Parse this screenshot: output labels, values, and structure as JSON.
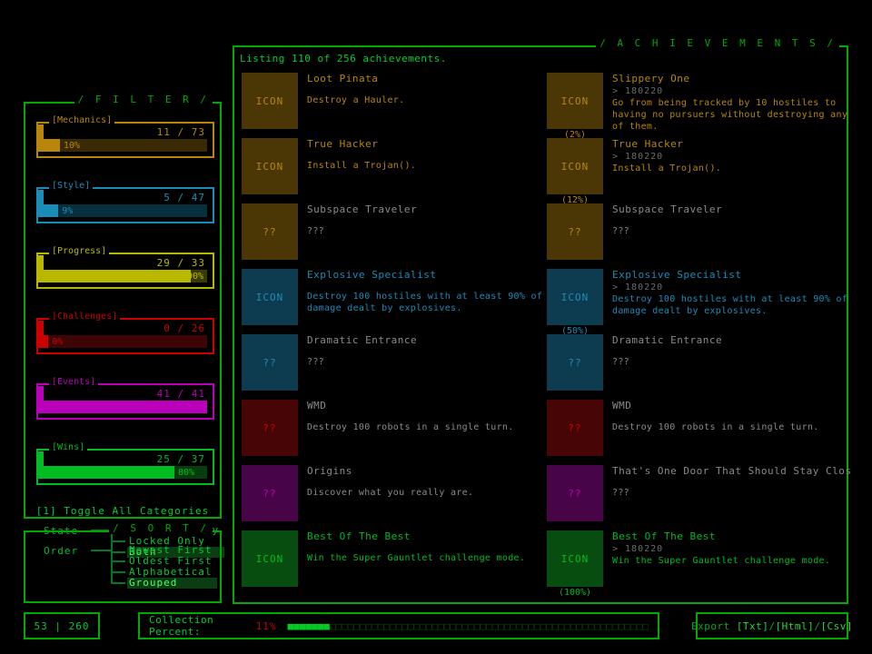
{
  "theme": {
    "green": "#00aa00",
    "bright_green": "#22dd33",
    "background": "#000000",
    "locked_text": "#8a8a8a"
  },
  "filter_panel": {
    "title": "/ F I L T E R /",
    "categories": [
      {
        "label": "[Mechanics]",
        "count": "11 / 73",
        "percent_label": "10%",
        "percent": 10,
        "color": "#b8860b",
        "dim": "#3a2a04"
      },
      {
        "label": "[Style]",
        "count": "5 / 47",
        "percent_label": "9%",
        "percent": 9,
        "color": "#1a8cb8",
        "dim": "#07303f"
      },
      {
        "label": "[Progress]",
        "count": "29 / 33",
        "percent_label": "90%",
        "percent": 90,
        "color": "#b8b800",
        "dim": "#3a3a05"
      },
      {
        "label": "[Challenges]",
        "count": "0 / 26",
        "percent_label": "0%",
        "percent": 0,
        "color": "#cc0000",
        "dim": "#3d0505"
      },
      {
        "label": "[Events]",
        "count": "41 / 41",
        "percent_label": "",
        "percent": 100,
        "color": "#bb00bb",
        "dim": "#3a043a"
      },
      {
        "label": "[Wins]",
        "count": "25 / 37",
        "percent_label": "80%",
        "percent": 80,
        "color": "#00bb22",
        "dim": "#053d0d"
      }
    ],
    "toggle_all": "[1] Toggle All Categories",
    "state": {
      "key": "State",
      "options": [
        "Unlocked Only",
        "Locked Only",
        "Both"
      ],
      "selected_index": 2
    }
  },
  "sort_panel": {
    "title": "/ S O R T /",
    "order": {
      "key": "Order",
      "options": [
        "Newest First",
        "Oldest First",
        "Alphabetical",
        "Grouped"
      ],
      "selected_index": 3
    }
  },
  "achievements_panel": {
    "title": "/ A C H I E V E M E N T S /",
    "listing": "Listing 110 of 256 achievements.",
    "icon_unlocked_text": "ICON",
    "icon_locked_text": "??",
    "locked_desc": "???",
    "left_column": [
      {
        "title": "Loot Pinata",
        "date": "",
        "desc": "Destroy a Hauler.",
        "pct": "",
        "locked": false,
        "color": "#b8860b",
        "box": "#4a3705"
      },
      {
        "title": "True Hacker",
        "date": "",
        "desc": "Install a Trojan().",
        "pct": "",
        "locked": false,
        "color": "#b8860b",
        "box": "#4a3705"
      },
      {
        "title": "Subspace Traveler",
        "date": "",
        "desc": "???",
        "pct": "",
        "locked": true,
        "color": "#b8860b",
        "box": "#4a3705"
      },
      {
        "title": "Explosive Specialist",
        "date": "",
        "desc": "Destroy 100 hostiles with at least 90% of damage dealt by explosives.",
        "pct": "",
        "locked": false,
        "color": "#1a8cb8",
        "box": "#0d3b50"
      },
      {
        "title": "Dramatic Entrance",
        "date": "",
        "desc": "???",
        "pct": "",
        "locked": true,
        "color": "#1a8cb8",
        "box": "#0d3b50"
      },
      {
        "title": "WMD",
        "date": "",
        "desc": "Destroy 100 robots in a single turn.",
        "pct": "",
        "locked": true,
        "color": "#cc0000",
        "box": "#470505"
      },
      {
        "title": "Origins",
        "date": "",
        "desc": "Discover what you really are.",
        "pct": "",
        "locked": true,
        "color": "#bb00bb",
        "box": "#470447"
      },
      {
        "title": "Best Of The Best",
        "date": "",
        "desc": "Win the Super Gauntlet challenge mode.",
        "pct": "",
        "locked": false,
        "color": "#00bb22",
        "box": "#084d10"
      }
    ],
    "right_column": [
      {
        "title": "Slippery One",
        "date": "> 180220",
        "desc": "Go from being tracked by 10 hostiles to having no pursuers without destroying any of them.",
        "pct": "(2%)",
        "locked": false,
        "color": "#b8860b",
        "box": "#4a3705"
      },
      {
        "title": "True Hacker",
        "date": "> 180220",
        "desc": "Install a Trojan().",
        "pct": "(12%)",
        "locked": false,
        "color": "#b8860b",
        "box": "#4a3705"
      },
      {
        "title": "Subspace Traveler",
        "date": "",
        "desc": "???",
        "pct": "",
        "locked": true,
        "color": "#b8860b",
        "box": "#4a3705"
      },
      {
        "title": "Explosive Specialist",
        "date": "> 180220",
        "desc": "Destroy 100 hostiles with at least 90% of damage dealt by explosives.",
        "pct": "(50%)",
        "locked": false,
        "color": "#1a8cb8",
        "box": "#0d3b50"
      },
      {
        "title": "Dramatic Entrance",
        "date": "",
        "desc": "???",
        "pct": "",
        "locked": true,
        "color": "#1a8cb8",
        "box": "#0d3b50"
      },
      {
        "title": "WMD",
        "date": "",
        "desc": "Destroy 100 robots in a single turn.",
        "pct": "",
        "locked": true,
        "color": "#cc0000",
        "box": "#470505"
      },
      {
        "title": "That's One Door That Should Stay Closed",
        "date": "",
        "desc": "???",
        "pct": "",
        "locked": true,
        "color": "#bb00bb",
        "box": "#470447"
      },
      {
        "title": "Best Of The Best",
        "date": "> 180220",
        "desc": "Win the Super Gauntlet challenge mode.",
        "pct": "(100%)",
        "locked": false,
        "color": "#00bb22",
        "box": "#084d10"
      }
    ]
  },
  "status_bar": {
    "score": "53 | 260",
    "collection_label": "Collection Percent:",
    "collection_percent_text": "11%",
    "collection_percent": 11,
    "meter_total_cells": 60,
    "export_label": "Export",
    "export_options": [
      "[Txt]",
      "[Html]",
      "[Csv]"
    ],
    "export_separator": "/"
  }
}
